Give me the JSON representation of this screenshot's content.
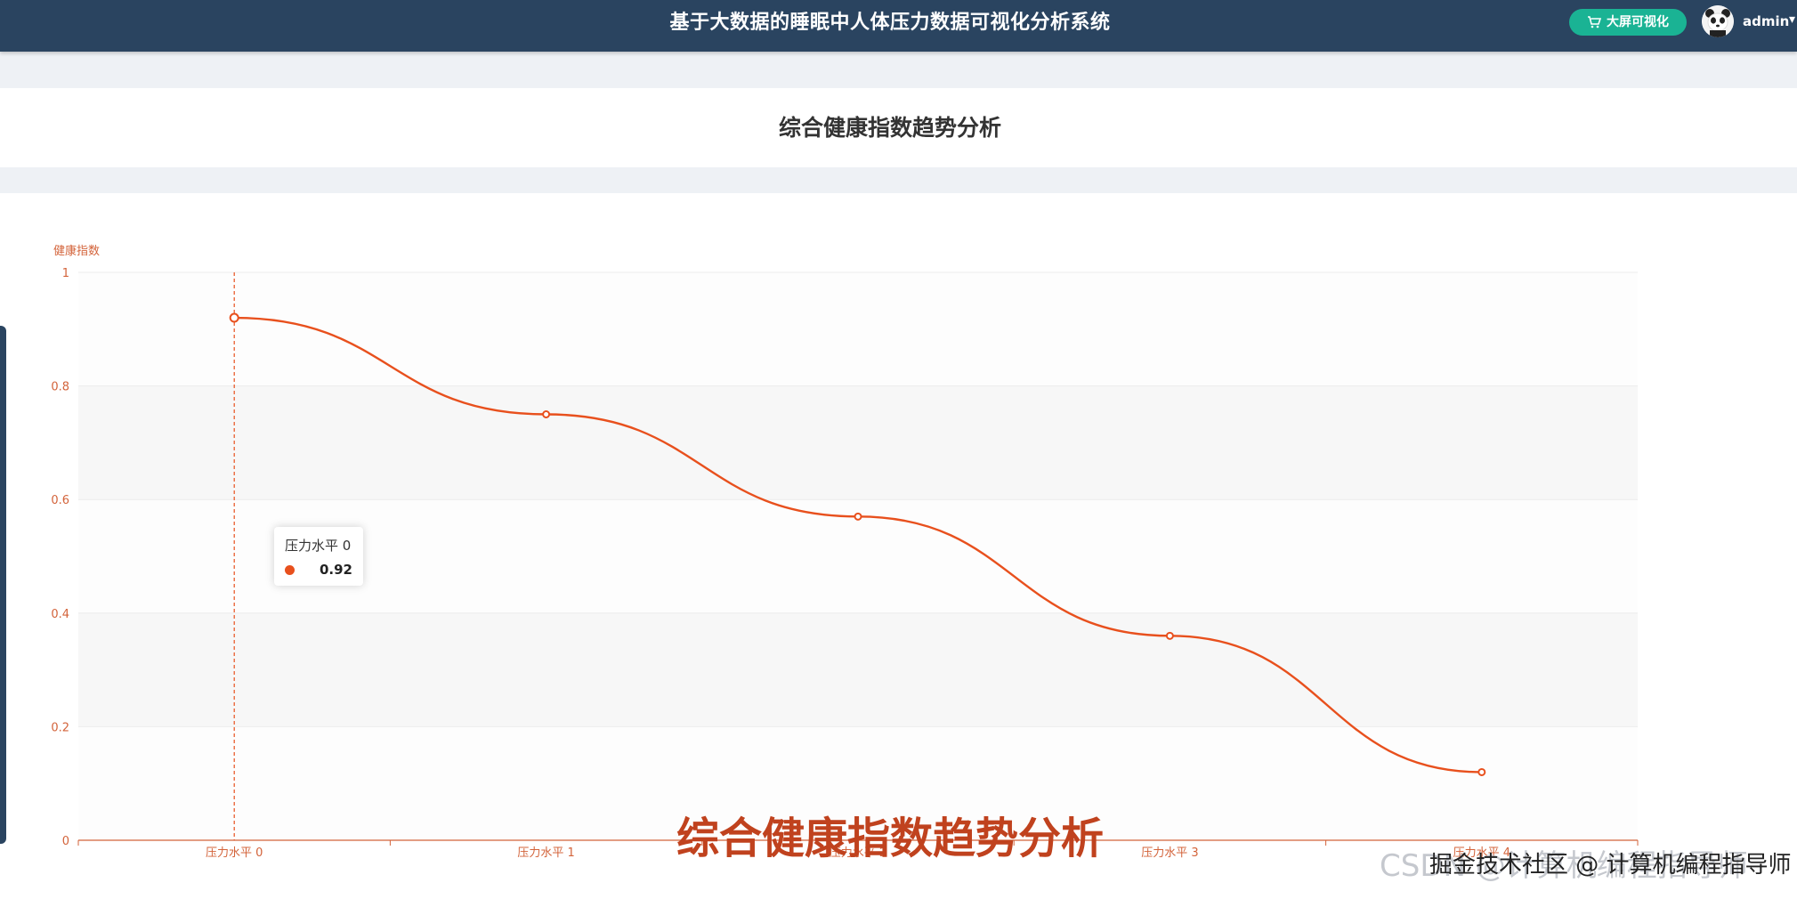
{
  "header": {
    "system_title": "基于大数据的睡眠中人体压力数据可视化分析系统",
    "bigscreen_label": "大屏可视化",
    "user_name": "admin"
  },
  "page": {
    "title": "综合健康指数趋势分析",
    "caption": "综合健康指数趋势分析"
  },
  "tooltip": {
    "title": "压力水平 0",
    "value": "0.92"
  },
  "watermark": {
    "text": "CSDN @计算机编程指导师",
    "overlay": "掘金技术社区 @ 计算机编程指导师"
  },
  "colors": {
    "series": "#e8501d",
    "header_bg": "#2a4460",
    "button_bg": "#1ab394",
    "axis": "#d3633a"
  },
  "chart_data": {
    "type": "line",
    "title": "",
    "xlabel": "",
    "ylabel": "健康指数",
    "categories": [
      "压力水平 0",
      "压力水平 1",
      "压力水平 2",
      "压力水平 3",
      "压力水平 4"
    ],
    "series": [
      {
        "values": [
          0.92,
          0.75,
          0.57,
          0.36,
          0.12
        ]
      }
    ],
    "ylim": [
      0,
      1
    ],
    "yticks": [
      0,
      0.2,
      0.4,
      0.6,
      0.8,
      1
    ],
    "ytick_labels": [
      "0",
      "0.2",
      "0.4",
      "0.6",
      "0.8",
      "1"
    ],
    "grid": true,
    "highlighted_category": "压力水平 0"
  }
}
